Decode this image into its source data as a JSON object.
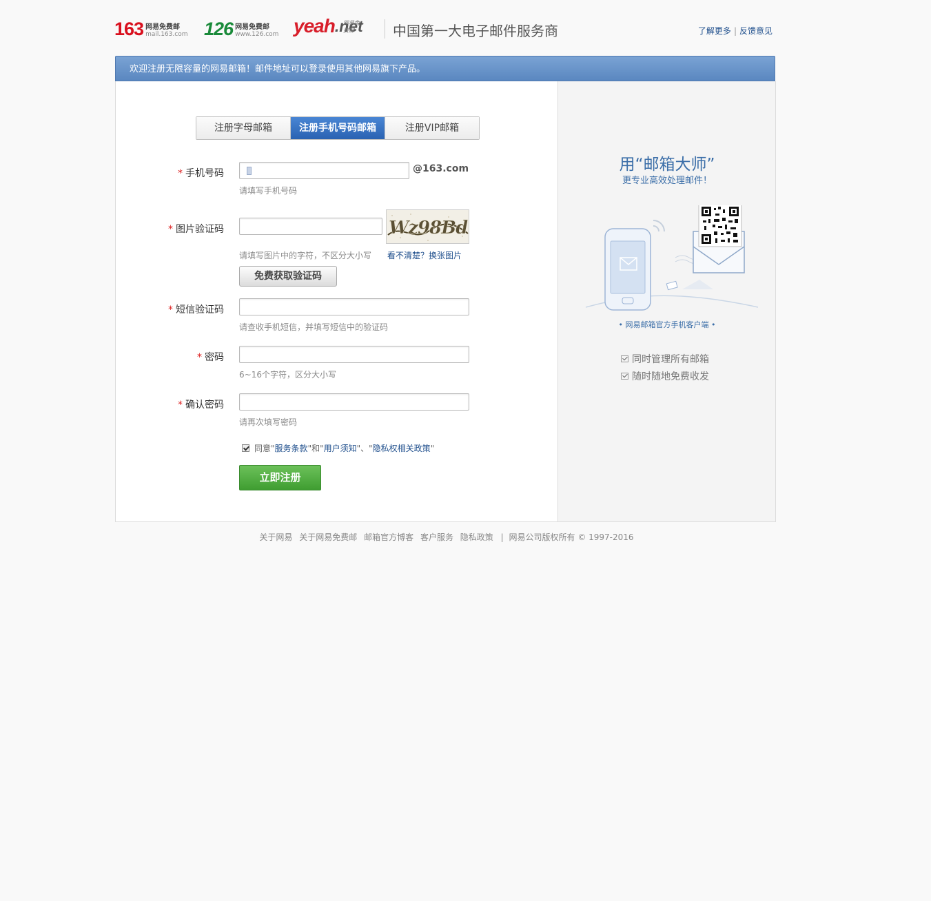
{
  "header": {
    "logo163": {
      "num": "163",
      "cn": "网易免费邮",
      "en": "mail.163.com"
    },
    "logo126": {
      "num": "126",
      "cn": "网易免费邮",
      "en": "www.126.com"
    },
    "logoyeah": {
      "word": "yeah",
      "net": ".net",
      "tag": "网易免费邮"
    },
    "slogan": "中国第一大电子邮件服务商",
    "link_more": "了解更多",
    "link_feedback": "反馈意见"
  },
  "banner": "欢迎注册无限容量的网易邮箱！邮件地址可以登录使用其他网易旗下产品。",
  "tabs": [
    "注册字母邮箱",
    "注册手机号码邮箱",
    "注册VIP邮箱"
  ],
  "form": {
    "phone": {
      "label": "手机号码",
      "suffix": "@163.com",
      "hint": "请填写手机号码"
    },
    "captcha": {
      "label": "图片验证码",
      "hint": "请填写图片中的字符，不区分大小写",
      "refresh": "看不清楚？换张图片",
      "text": "Wz98Bd"
    },
    "get_code": "免费获取验证码",
    "sms": {
      "label": "短信验证码",
      "hint": "请查收手机短信，并填写短信中的验证码"
    },
    "password": {
      "label": "密码",
      "hint": "6~16个字符，区分大小写"
    },
    "confirm": {
      "label": "确认密码",
      "hint": "请再次填写密码"
    },
    "agree": {
      "prefix": "同意",
      "q1": "\"",
      "terms": "服务条款",
      "q2": "\"和\"",
      "notice": "用户须知",
      "q3": "\"、\"",
      "privacy": "隐私权相关政策",
      "q4": "\""
    },
    "submit": "立即注册"
  },
  "sidebar": {
    "title": "用“邮箱大师”",
    "subtitle": "更专业高效处理邮件！",
    "client_label": "• 网易邮箱官方手机客户端 •",
    "features": [
      "同时管理所有邮箱",
      "随时随地免费收发"
    ]
  },
  "footer": {
    "links": [
      "关于网易",
      "关于网易免费邮",
      "邮箱官方博客",
      "客户服务",
      "隐私政策"
    ],
    "sep": "|",
    "copyright": "网易公司版权所有 © 1997-2016"
  }
}
